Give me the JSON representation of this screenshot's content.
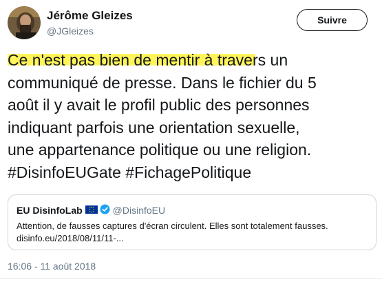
{
  "author": {
    "name": "Jérôme Gleizes",
    "handle": "@JGleizes"
  },
  "follow_button": {
    "label": "Suivre"
  },
  "tweet": {
    "text": "Ce n'est pas bien de mentir à  travers un\ncommuniqué de presse. Dans le fichier du 5\naoût il y avait le profil public des personnes\nindiquant parfois une orientation sexuelle,\nune appartenance politique ou une religion.\n#DisinfoEUGate #FichagePolitique",
    "highlight_color": "#fff45a"
  },
  "quoted_tweet": {
    "name": "EU DisinfoLab",
    "flag_icon": "eu-flag-icon",
    "verified_icon": "verified-badge-icon",
    "handle": "@DisinfoEU",
    "text": "Attention, de fausses captures d'écran circulent. Elles sont totalement fausses.",
    "link": "disinfo.eu/2018/08/11/11-..."
  },
  "timestamp": "16:06 - 11 août 2018",
  "colors": {
    "text": "#14171a",
    "secondary": "#657786",
    "border": "#ccd6dd",
    "verified": "#1da1f2",
    "eu_blue": "#003399",
    "eu_gold": "#ffcc00"
  }
}
